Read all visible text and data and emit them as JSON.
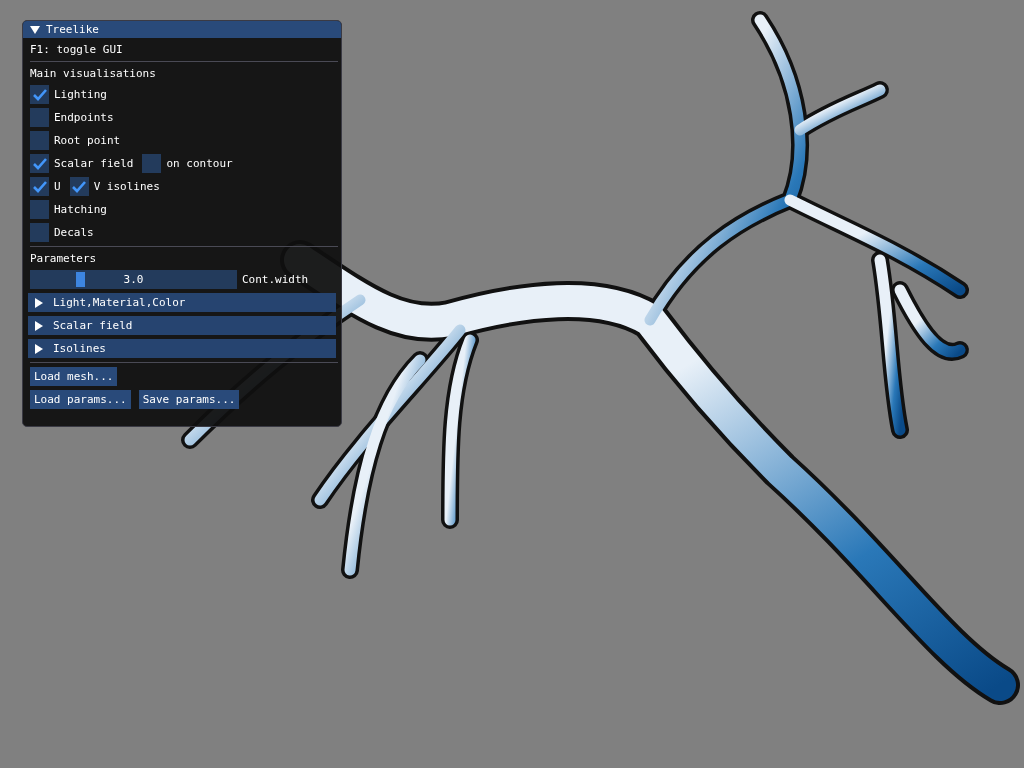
{
  "window": {
    "title": "Treelike",
    "expanded": true
  },
  "hint": "F1: toggle GUI",
  "main_visualisations": {
    "title": "Main visualisations",
    "rows": [
      [
        {
          "label": "Lighting",
          "checked": true
        }
      ],
      [
        {
          "label": "Endpoints",
          "checked": false
        }
      ],
      [
        {
          "label": "Root point",
          "checked": false
        }
      ],
      [
        {
          "label": "Scalar field",
          "checked": true
        },
        {
          "label": "on contour",
          "checked": false
        }
      ],
      [
        {
          "label": "U",
          "checked": true
        },
        {
          "label": "V isolines",
          "checked": true
        }
      ],
      [
        {
          "label": "Hatching",
          "checked": false
        }
      ],
      [
        {
          "label": "Decals",
          "checked": false
        }
      ]
    ]
  },
  "parameters": {
    "title": "Parameters",
    "slider": {
      "label": "Cont.width",
      "value": "3.0",
      "level": 0.23
    }
  },
  "sections": [
    {
      "label": "Light,Material,Color",
      "expanded": false
    },
    {
      "label": "Scalar field",
      "expanded": false
    },
    {
      "label": "Isolines",
      "expanded": false
    }
  ],
  "button_rows": [
    [
      "Load mesh..."
    ],
    [
      "Load params...",
      "Save params..."
    ]
  ]
}
